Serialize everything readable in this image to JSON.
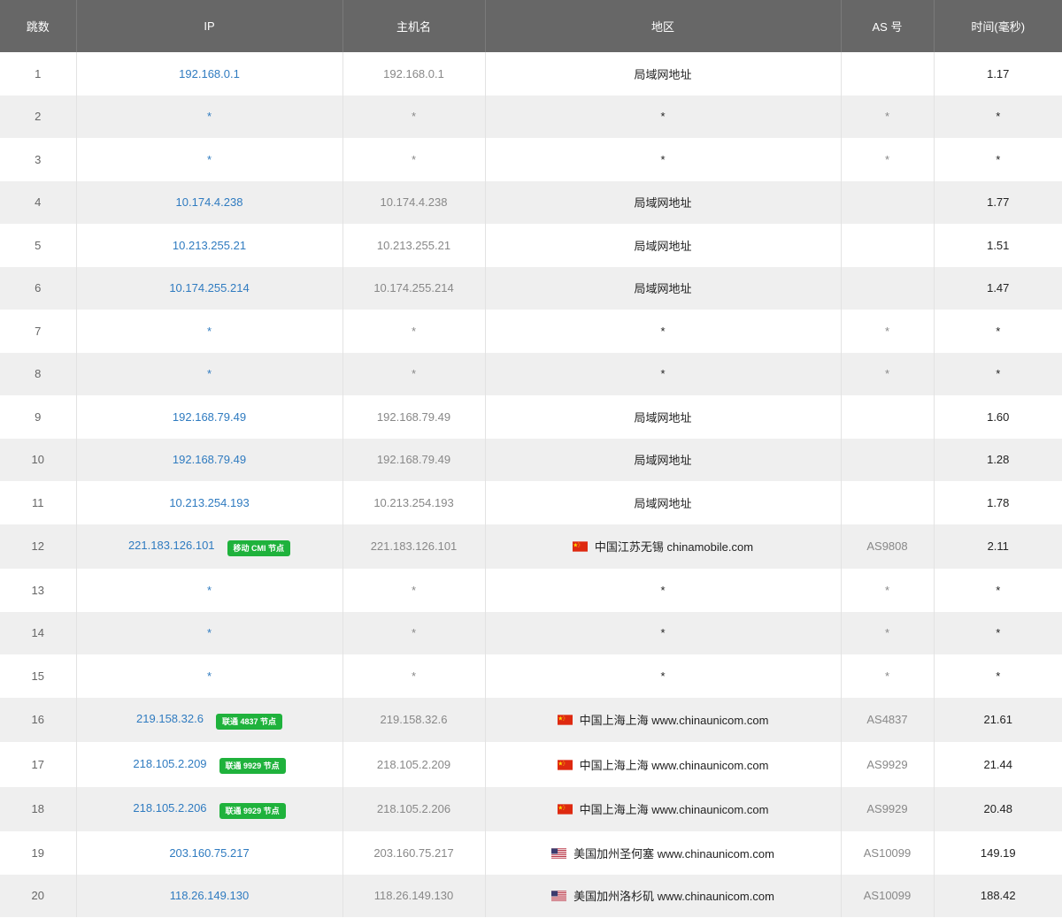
{
  "header": {
    "hop": "跳数",
    "ip": "IP",
    "host": "主机名",
    "region": "地区",
    "as": "AS 号",
    "time": "时间(毫秒)"
  },
  "rows": [
    {
      "hop": "1",
      "ip": "192.168.0.1",
      "badge": "",
      "host": "192.168.0.1",
      "region": "局域网地址",
      "flag": "",
      "as": "",
      "time": "1.17"
    },
    {
      "hop": "2",
      "ip": "*",
      "badge": "",
      "host": "*",
      "region": "*",
      "flag": "",
      "as": "*",
      "time": "*"
    },
    {
      "hop": "3",
      "ip": "*",
      "badge": "",
      "host": "*",
      "region": "*",
      "flag": "",
      "as": "*",
      "time": "*"
    },
    {
      "hop": "4",
      "ip": "10.174.4.238",
      "badge": "",
      "host": "10.174.4.238",
      "region": "局域网地址",
      "flag": "",
      "as": "",
      "time": "1.77"
    },
    {
      "hop": "5",
      "ip": "10.213.255.21",
      "badge": "",
      "host": "10.213.255.21",
      "region": "局域网地址",
      "flag": "",
      "as": "",
      "time": "1.51"
    },
    {
      "hop": "6",
      "ip": "10.174.255.214",
      "badge": "",
      "host": "10.174.255.214",
      "region": "局域网地址",
      "flag": "",
      "as": "",
      "time": "1.47"
    },
    {
      "hop": "7",
      "ip": "*",
      "badge": "",
      "host": "*",
      "region": "*",
      "flag": "",
      "as": "*",
      "time": "*"
    },
    {
      "hop": "8",
      "ip": "*",
      "badge": "",
      "host": "*",
      "region": "*",
      "flag": "",
      "as": "*",
      "time": "*"
    },
    {
      "hop": "9",
      "ip": "192.168.79.49",
      "badge": "",
      "host": "192.168.79.49",
      "region": "局域网地址",
      "flag": "",
      "as": "",
      "time": "1.60"
    },
    {
      "hop": "10",
      "ip": "192.168.79.49",
      "badge": "",
      "host": "192.168.79.49",
      "region": "局域网地址",
      "flag": "",
      "as": "",
      "time": "1.28"
    },
    {
      "hop": "11",
      "ip": "10.213.254.193",
      "badge": "",
      "host": "10.213.254.193",
      "region": "局域网地址",
      "flag": "",
      "as": "",
      "time": "1.78"
    },
    {
      "hop": "12",
      "ip": "221.183.126.101",
      "badge": "移动 CMI 节点",
      "host": "221.183.126.101",
      "region": "中国江苏无锡 chinamobile.com",
      "flag": "cn-flag-icon",
      "as": "AS9808",
      "time": "2.11"
    },
    {
      "hop": "13",
      "ip": "*",
      "badge": "",
      "host": "*",
      "region": "*",
      "flag": "",
      "as": "*",
      "time": "*"
    },
    {
      "hop": "14",
      "ip": "*",
      "badge": "",
      "host": "*",
      "region": "*",
      "flag": "",
      "as": "*",
      "time": "*"
    },
    {
      "hop": "15",
      "ip": "*",
      "badge": "",
      "host": "*",
      "region": "*",
      "flag": "",
      "as": "*",
      "time": "*"
    },
    {
      "hop": "16",
      "ip": "219.158.32.6",
      "badge": "联通 4837 节点",
      "host": "219.158.32.6",
      "region": "中国上海上海 www.chinaunicom.com",
      "flag": "cn-flag-icon",
      "as": "AS4837",
      "time": "21.61"
    },
    {
      "hop": "17",
      "ip": "218.105.2.209",
      "badge": "联通 9929 节点",
      "host": "218.105.2.209",
      "region": "中国上海上海 www.chinaunicom.com",
      "flag": "cn-flag-icon",
      "as": "AS9929",
      "time": "21.44"
    },
    {
      "hop": "18",
      "ip": "218.105.2.206",
      "badge": "联通 9929 节点",
      "host": "218.105.2.206",
      "region": "中国上海上海 www.chinaunicom.com",
      "flag": "cn-flag-icon",
      "as": "AS9929",
      "time": "20.48"
    },
    {
      "hop": "19",
      "ip": "203.160.75.217",
      "badge": "",
      "host": "203.160.75.217",
      "region": "美国加州圣何塞 www.chinaunicom.com",
      "flag": "us-flag-icon",
      "as": "AS10099",
      "time": "149.19"
    },
    {
      "hop": "20",
      "ip": "118.26.149.130",
      "badge": "",
      "host": "118.26.149.130",
      "region": "美国加州洛杉矶 www.chinaunicom.com",
      "flag": "us-flag-icon",
      "as": "AS10099",
      "time": "188.42"
    }
  ],
  "colors": {
    "header_bg": "#676767",
    "ip_link": "#2f7bc0",
    "badge_bg": "#1fb23c",
    "alt_row_bg": "#efefef"
  }
}
